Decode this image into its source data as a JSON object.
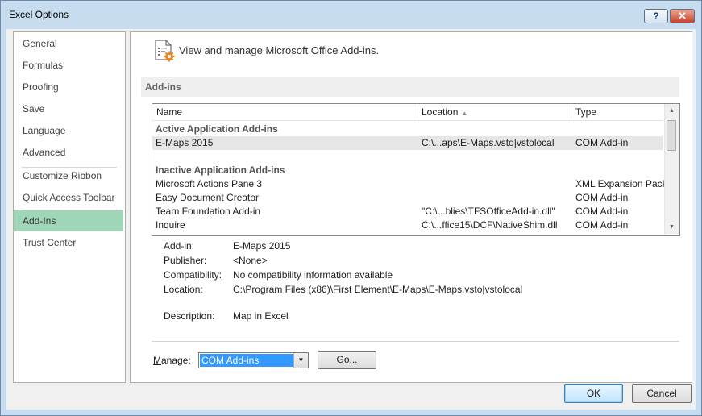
{
  "window": {
    "title": "Excel Options",
    "help_glyph": "?",
    "close_glyph": "✕"
  },
  "nav": {
    "items": [
      {
        "label": "General"
      },
      {
        "label": "Formulas"
      },
      {
        "label": "Proofing"
      },
      {
        "label": "Save"
      },
      {
        "label": "Language"
      },
      {
        "label": "Advanced"
      },
      {
        "label": "Customize Ribbon"
      },
      {
        "label": "Quick Access Toolbar"
      },
      {
        "label": "Add-Ins",
        "active": true
      },
      {
        "label": "Trust Center"
      }
    ]
  },
  "main": {
    "header_icon": "addins-gear-icon",
    "header_text": "View and manage Microsoft Office Add-ins.",
    "section_label": "Add-ins",
    "columns": {
      "name": "Name",
      "location": "Location",
      "type": "Type"
    },
    "rows": [
      {
        "kind": "group",
        "name": "Active Application Add-ins"
      },
      {
        "kind": "item",
        "name": "E-Maps 2015",
        "location": "C:\\...aps\\E-Maps.vsto|vstolocal",
        "type": "COM Add-in",
        "selected": true
      },
      {
        "kind": "item",
        "name": "Inactive Application Add-ins",
        "group": true
      },
      {
        "kind": "item",
        "name": "Microsoft Actions Pane 3",
        "location": "",
        "type": "XML Expansion Pack"
      },
      {
        "kind": "item",
        "name": "Easy Document Creator",
        "location": "",
        "type": "COM Add-in"
      },
      {
        "kind": "item",
        "name": "Team Foundation Add-in",
        "location": "\"C:\\...blies\\TFSOfficeAdd-in.dll\"",
        "type": "COM Add-in"
      },
      {
        "kind": "item",
        "name": "Inquire",
        "location": "C:\\...ffice15\\DCF\\NativeShim.dll",
        "type": "COM Add-in"
      }
    ],
    "details": {
      "addin_label": "Add-in:",
      "addin_value": "E-Maps 2015",
      "publisher_label": "Publisher:",
      "publisher_value": "<None>",
      "compat_label": "Compatibility:",
      "compat_value": "No compatibility information available",
      "location_label": "Location:",
      "location_value": "C:\\Program Files (x86)\\First Element\\E-Maps\\E-Maps.vsto|vstolocal",
      "desc_label": "Description:",
      "desc_value": "Map in Excel"
    },
    "manage": {
      "label_prefix": "M",
      "label_rest": "anage:",
      "selected": "COM Add-ins",
      "go_prefix": "G",
      "go_rest": "o..."
    }
  },
  "footer": {
    "ok": "OK",
    "cancel": "Cancel"
  },
  "colors": {
    "active_nav": "#9fd6b7",
    "selection": "#3399ff",
    "frame": "#c8dcef"
  }
}
